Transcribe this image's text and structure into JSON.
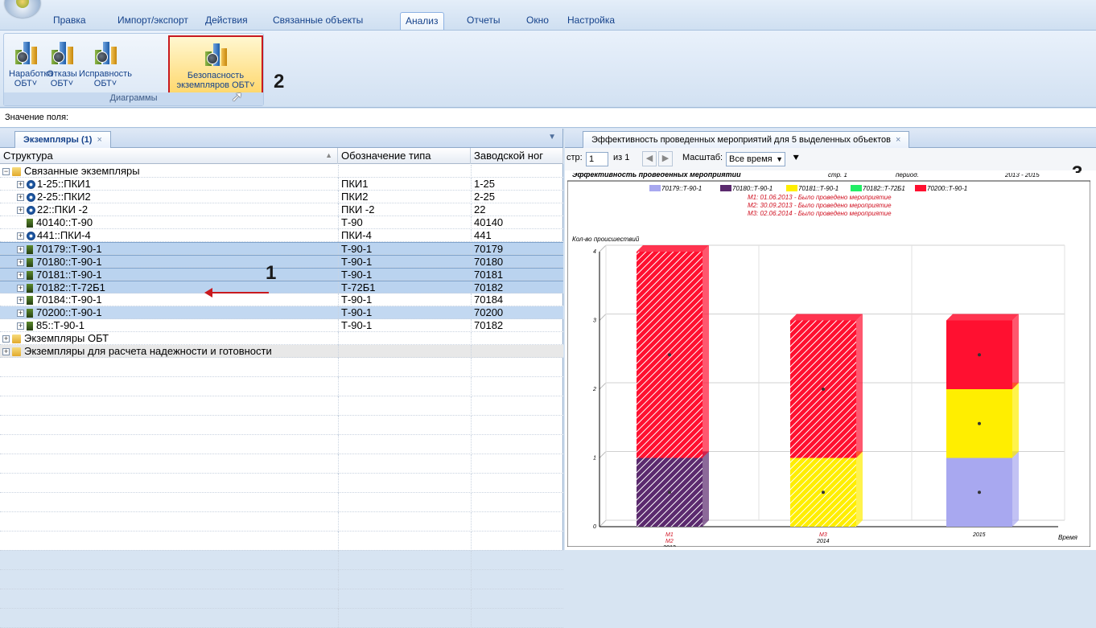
{
  "ribbon_tabs": [
    "Правка",
    "Импорт/экспорт",
    "Действия",
    "Связанные объекты",
    "Анализ",
    "Отчеты",
    "Окно",
    "Настройка"
  ],
  "ribbon_active_tab": "Анализ",
  "ribbon_buttons": [
    {
      "line1": "Наработка",
      "line2": "ОБТ˅"
    },
    {
      "line1": "Отказы",
      "line2": "ОБТ˅"
    },
    {
      "line1": "Исправность",
      "line2": "ОБТ˅"
    },
    {
      "line1": "Безопасность",
      "line2": "экземпляров ОБТ˅"
    }
  ],
  "ribbon_group_label": "Диаграммы",
  "annotations": {
    "a1": "1",
    "a2": "2",
    "a3": "3"
  },
  "field_bar_label": "Значение поля:",
  "left_tab_label": "Экземпляры (1)",
  "left_tab_close": "×",
  "grid": {
    "headers": [
      "Структура",
      "Обозначение типа",
      "Заводской ног"
    ],
    "rows": [
      {
        "name": "Связанные экземпляры",
        "type": "",
        "num": "",
        "kind": "folder",
        "level": 0,
        "pm": "−"
      },
      {
        "name": "1-25::ПКИ1",
        "type": "ПКИ1",
        "num": "1-25",
        "kind": "gear",
        "level": 1,
        "pm": "+"
      },
      {
        "name": "2-25::ПКИ2",
        "type": "ПКИ2",
        "num": "2-25",
        "kind": "gear",
        "level": 1,
        "pm": "+"
      },
      {
        "name": "22::ПКИ -2",
        "type": "ПКИ -2",
        "num": "22",
        "kind": "gear",
        "level": 1,
        "pm": "+"
      },
      {
        "name": "40140::Т-90",
        "type": "Т-90",
        "num": "40140",
        "kind": "eq",
        "level": 1,
        "pm": ""
      },
      {
        "name": "441::ПКИ-4",
        "type": "ПКИ-4",
        "num": "441",
        "kind": "gear",
        "level": 1,
        "pm": "+"
      },
      {
        "name": "70179::Т-90-1",
        "type": "Т-90-1",
        "num": "70179",
        "kind": "eq",
        "level": 1,
        "pm": "+",
        "sel": 1
      },
      {
        "name": "70180::Т-90-1",
        "type": "Т-90-1",
        "num": "70180",
        "kind": "eq",
        "level": 1,
        "pm": "+",
        "sel": 1
      },
      {
        "name": "70181::Т-90-1",
        "type": "Т-90-1",
        "num": "70181",
        "kind": "eq",
        "level": 1,
        "pm": "+",
        "sel": 1
      },
      {
        "name": "70182::Т-72Б1",
        "type": "Т-72Б1",
        "num": "70182",
        "kind": "eq",
        "level": 1,
        "pm": "+",
        "sel": 1
      },
      {
        "name": "70184::Т-90-1",
        "type": "Т-90-1",
        "num": "70184",
        "kind": "eq",
        "level": 1,
        "pm": "+"
      },
      {
        "name": "70200::Т-90-1",
        "type": "Т-90-1",
        "num": "70200",
        "kind": "eq",
        "level": 1,
        "pm": "+",
        "sel": 2
      },
      {
        "name": "85::Т-90-1",
        "type": "Т-90-1",
        "num": "70182",
        "kind": "eq",
        "level": 1,
        "pm": "+"
      },
      {
        "name": "Экземпляры ОБТ",
        "type": "",
        "num": "",
        "kind": "folder",
        "level": 0,
        "pm": "+"
      },
      {
        "name": "Экземпляры для расчета надежности и готовности",
        "type": "",
        "num": "",
        "kind": "folder",
        "level": 0,
        "pm": "+",
        "grp": 1
      }
    ]
  },
  "right_tab_label": "Эффективность проведенных мероприятий для 5 выделенных объектов",
  "right_tab_close": "×",
  "toolbar": {
    "page_label": "стр:",
    "page_value": "1",
    "of_label": "из 1",
    "scale_label": "Масштаб:",
    "scale_value": "Все время"
  },
  "report_header": {
    "title": "Эффективность проведенных мероприятий",
    "page": "стр. 1",
    "period_label": "период.",
    "period_value": "2013 - 2015"
  },
  "colors": {
    "s1": "#a8a8f0",
    "s2": "#5b2a6e",
    "s3": "#ffee00",
    "s4": "#22ee66",
    "s5": "#ff1030"
  },
  "chart_data": {
    "type": "bar",
    "stacked": true,
    "categories": [
      "2013",
      "2014",
      "2015"
    ],
    "category_event_labels": [
      [
        "M1",
        "M2"
      ],
      [
        "M3"
      ],
      []
    ],
    "series": [
      {
        "name": "70179::Т-90-1",
        "values": [
          0,
          0,
          1
        ],
        "color": "#a8a8f0"
      },
      {
        "name": "70180::Т-90-1",
        "values": [
          1,
          0,
          0
        ],
        "color": "#5b2a6e",
        "hatched": true
      },
      {
        "name": "70181::Т-90-1",
        "values": [
          0,
          1,
          1
        ],
        "color": "#ffee00"
      },
      {
        "name": "70182::Т-72Б1",
        "values": [
          0,
          0,
          0
        ],
        "color": "#22ee66"
      },
      {
        "name": "70200::Т-90-1",
        "values": [
          3,
          2,
          1
        ],
        "color": "#ff1030"
      }
    ],
    "hatched_categories": [
      "2013",
      "2014"
    ],
    "annotations": [
      "M1: 01.06.2013 - Было проведено мероприятие",
      "M2: 30.09.2013 - Было проведено мероприятие",
      "M3: 02.06.2014 - Было проведено мероприятие"
    ],
    "ylabel": "Кол-во происшествий",
    "xlabel": "Время",
    "ylim": [
      0,
      4
    ],
    "yticks": [
      "0",
      "1",
      "2",
      "3",
      "4"
    ],
    "grid": true,
    "legend_position": "top"
  }
}
